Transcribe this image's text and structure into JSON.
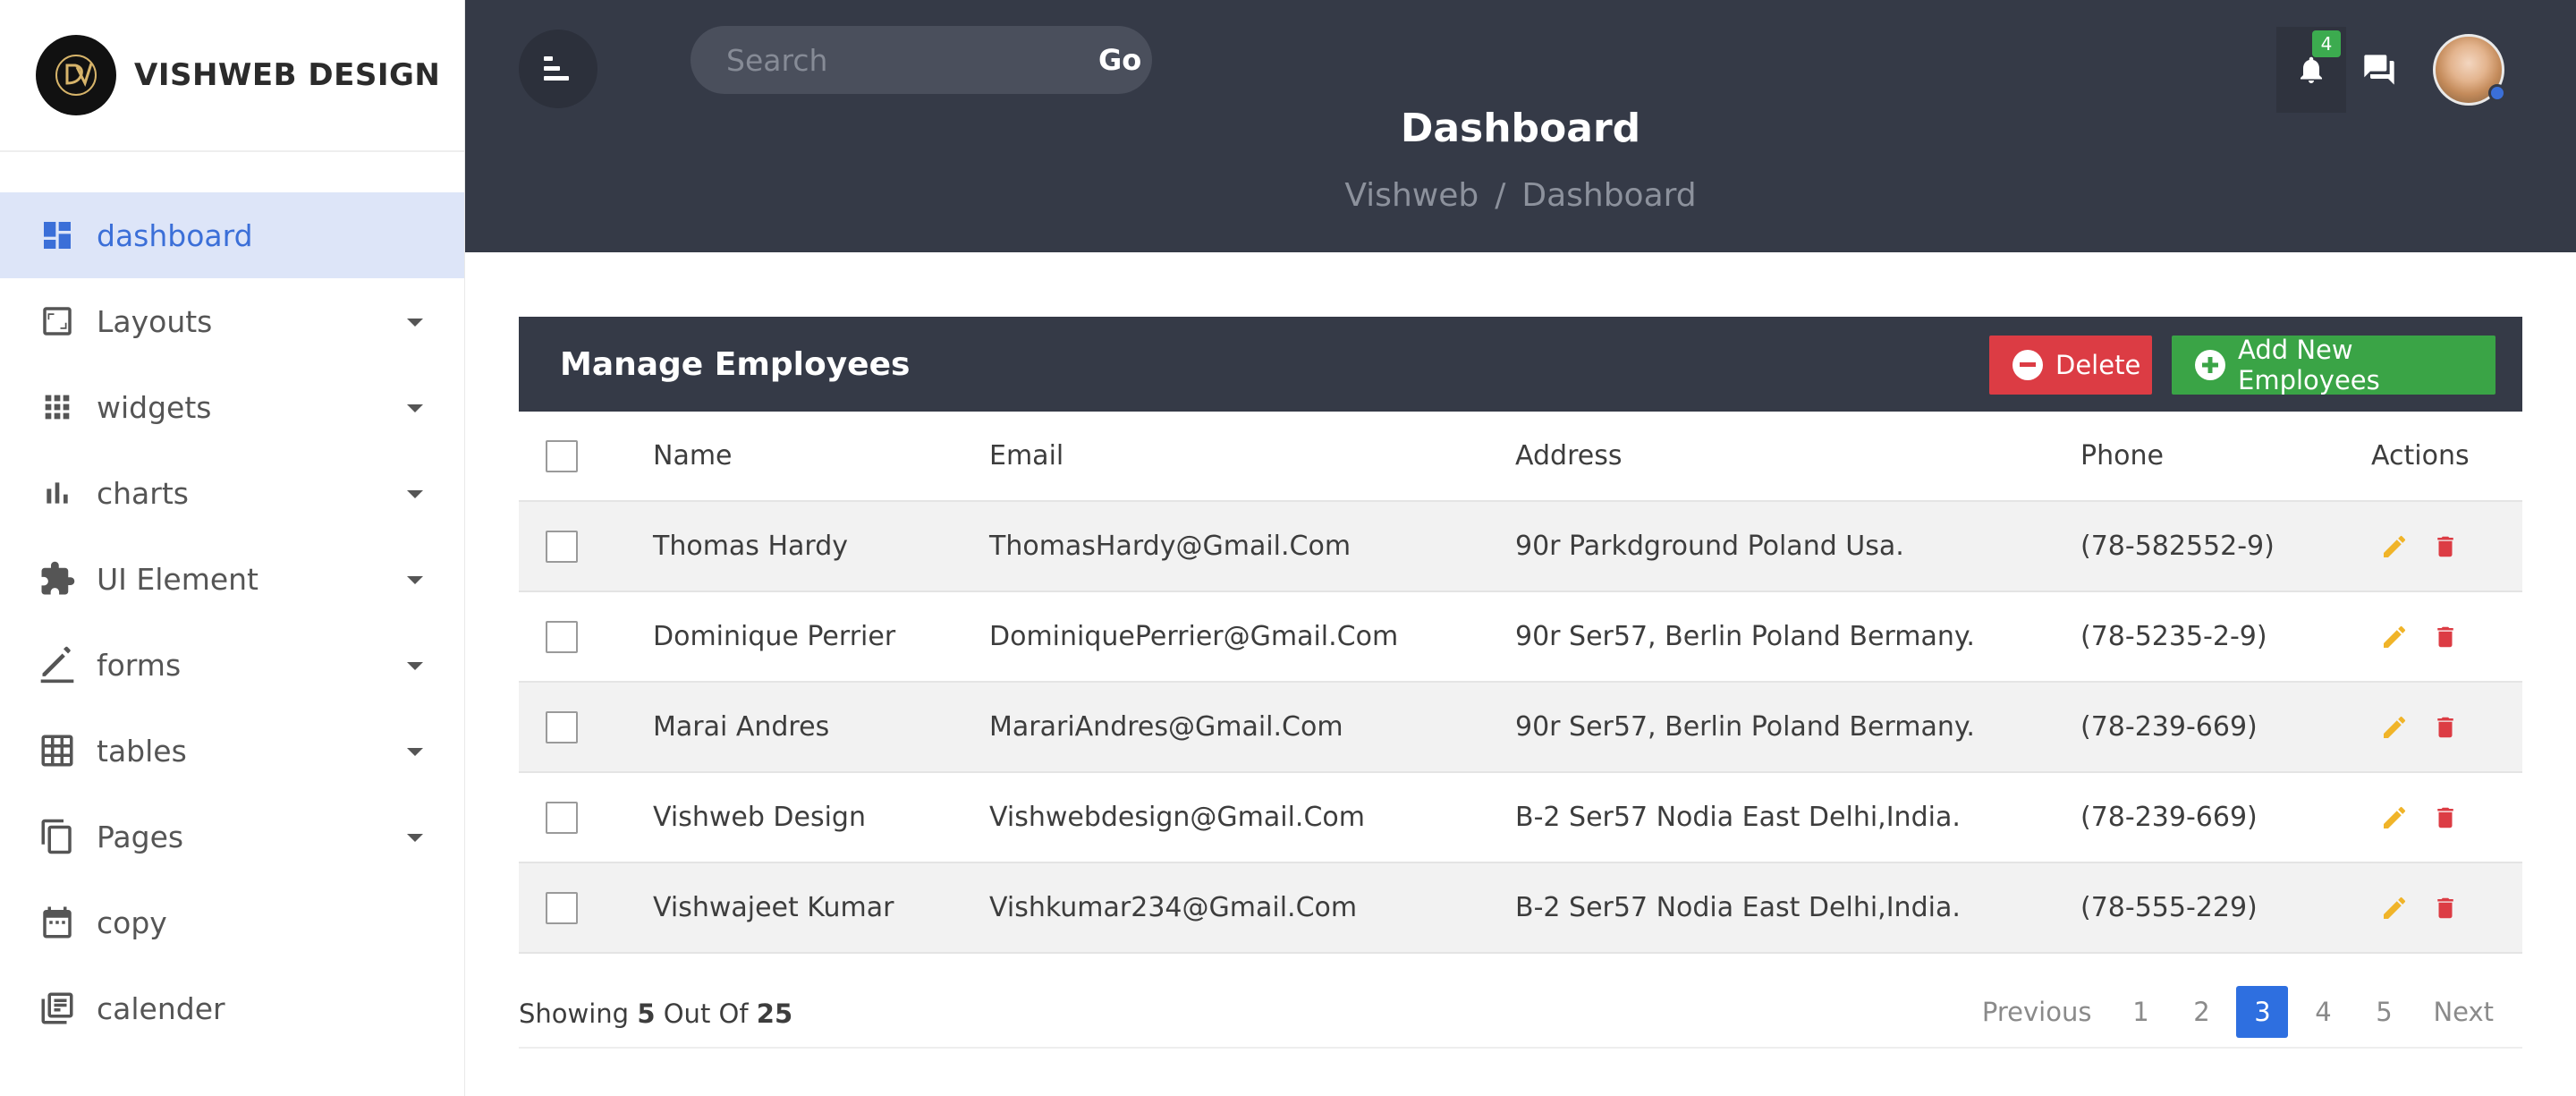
{
  "brand": {
    "name": "VISHWEB DESIGN",
    "logo_icon": "vishweb-logo-icon"
  },
  "sidebar": {
    "items": [
      {
        "label": "dashboard",
        "icon": "dashboard-icon",
        "active": true,
        "has_caret": false
      },
      {
        "label": "Layouts",
        "icon": "layout-icon",
        "has_caret": true
      },
      {
        "label": "widgets",
        "icon": "apps-grid-icon",
        "has_caret": true
      },
      {
        "label": "charts",
        "icon": "bar-chart-icon",
        "has_caret": true
      },
      {
        "label": "UI Element",
        "icon": "puzzle-icon",
        "has_caret": true
      },
      {
        "label": "forms",
        "icon": "pencil-icon",
        "has_caret": true
      },
      {
        "label": "tables",
        "icon": "table-icon",
        "has_caret": true
      },
      {
        "label": "Pages",
        "icon": "copy-pages-icon",
        "has_caret": true
      },
      {
        "label": "copy",
        "icon": "calendar-icon",
        "has_caret": false
      },
      {
        "label": "calender",
        "icon": "library-books-icon",
        "has_caret": false
      }
    ]
  },
  "header": {
    "search": {
      "placeholder": "Search",
      "go_label": "Go"
    },
    "notification_count": "4",
    "page_title": "Dashboard",
    "breadcrumb": {
      "root": "Vishweb",
      "separator": "/",
      "current": "Dashboard"
    }
  },
  "card": {
    "title": "Manage Employees",
    "delete_label": "Delete",
    "add_label": "Add New Employees"
  },
  "table": {
    "columns": {
      "name": "Name",
      "email": "Email",
      "address": "Address",
      "phone": "Phone",
      "actions": "Actions"
    },
    "rows": [
      {
        "name": "Thomas Hardy",
        "email": "ThomasHardy@Gmail.Com",
        "address": "90r Parkdground Poland Usa.",
        "phone": "(78-582552-9)"
      },
      {
        "name": "Dominique Perrier",
        "email": "DominiquePerrier@Gmail.Com",
        "address": "90r Ser57, Berlin Poland Bermany.",
        "phone": "(78-5235-2-9)"
      },
      {
        "name": "Marai Andres",
        "email": "MarariAndres@Gmail.Com",
        "address": "90r Ser57, Berlin Poland Bermany.",
        "phone": "(78-239-669)"
      },
      {
        "name": "Vishweb Design",
        "email": "Vishwebdesign@Gmail.Com",
        "address": "B-2 Ser57 Nodia East Delhi,India.",
        "phone": "(78-239-669)"
      },
      {
        "name": "Vishwajeet Kumar",
        "email": "Vishkumar234@Gmail.Com",
        "address": "B-2 Ser57 Nodia East Delhi,India.",
        "phone": "(78-555-229)"
      }
    ]
  },
  "footer": {
    "showing_prefix": "Showing",
    "showing_count": "5",
    "showing_middle": "Out Of",
    "showing_total": "25",
    "pagination": {
      "previous": "Previous",
      "pages": [
        "1",
        "2",
        "3",
        "4",
        "5"
      ],
      "active_page": "3",
      "next": "Next"
    }
  },
  "colors": {
    "header_bg": "#353a47",
    "active_nav_bg": "#dde5f8",
    "active_nav_text": "#3b6fd8",
    "delete": "#dc3c44",
    "add": "#3aa446",
    "edit_icon": "#f0b429",
    "trash_icon": "#dc3c44",
    "active_page": "#2e6fe0"
  }
}
